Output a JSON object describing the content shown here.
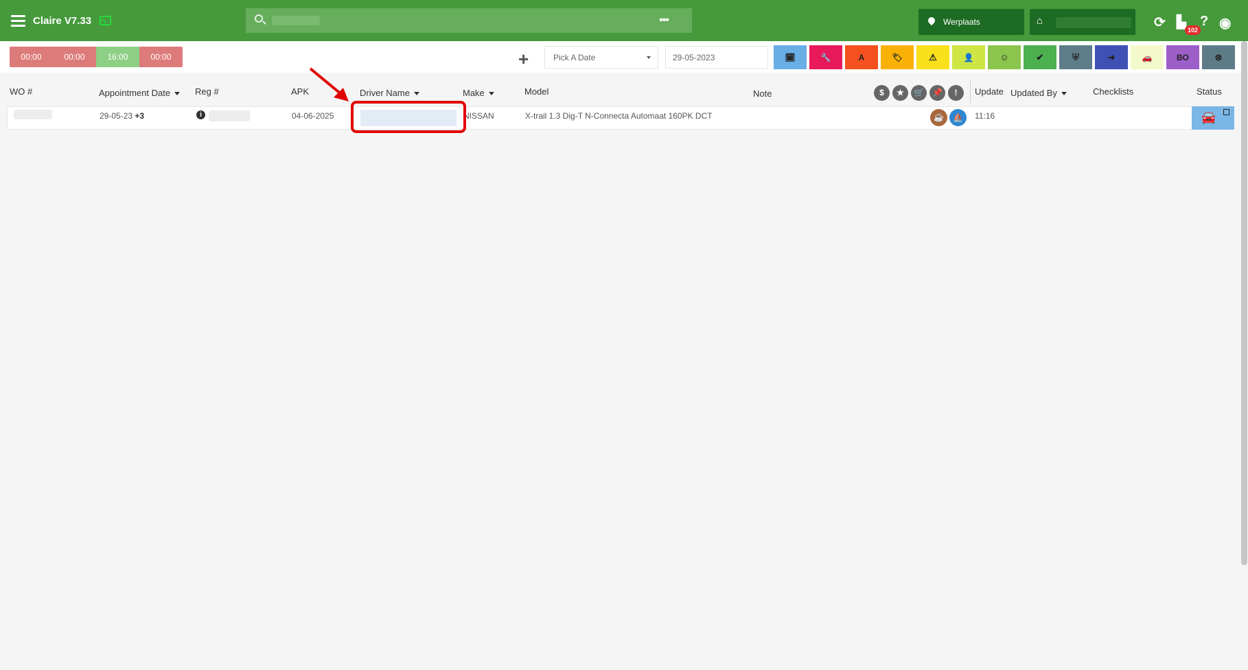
{
  "app": {
    "title": "Claire V7.33"
  },
  "search": {
    "placeholder": "",
    "more_label": "•••"
  },
  "location": {
    "label": "Werplaats"
  },
  "header_icons": {
    "notifications_count": "102",
    "help_label": "?"
  },
  "time_slots": [
    {
      "label": "00:00",
      "color": "#dd7b7b"
    },
    {
      "label": "00:00",
      "color": "#dd7b7b"
    },
    {
      "label": "16:00",
      "color": "#8ccf85"
    },
    {
      "label": "00:00",
      "color": "#dd7b7b"
    }
  ],
  "filters": {
    "add_label": "+",
    "pick_date_label": "Pick A Date",
    "date_value": "29-05-2023",
    "status_buttons": [
      {
        "name": "calendar-filter-button",
        "icon": "calendar-check-icon",
        "glyph": "🗓",
        "color": "#6aaee6"
      },
      {
        "name": "repair-filter-button",
        "icon": "wrench-icon",
        "glyph": "🔧",
        "color": "#e8195b"
      },
      {
        "name": "apk-filter-button",
        "icon": "apk-a-icon",
        "glyph": "A",
        "color": "#f4511e"
      },
      {
        "name": "tag-filter-button",
        "icon": "tag-icon",
        "glyph": "🏷",
        "color": "#f9b107"
      },
      {
        "name": "warning-filter-button",
        "icon": "warning-icon",
        "glyph": "⚠",
        "color": "#f8e11b"
      },
      {
        "name": "user-check-filter-button",
        "icon": "user-check-icon",
        "glyph": "👤",
        "color": "#cde643"
      },
      {
        "name": "smile-filter-button",
        "icon": "smile-icon",
        "glyph": "☺",
        "color": "#8cc54d"
      },
      {
        "name": "double-check-filter-button",
        "icon": "double-check-icon",
        "glyph": "✔",
        "color": "#4cb04f"
      },
      {
        "name": "shield-filter-button",
        "icon": "shield-check-icon",
        "glyph": "⛨",
        "color": "#5f7c89"
      },
      {
        "name": "exit-filter-button",
        "icon": "sign-out-icon",
        "glyph": "➜",
        "color": "#3f51b5"
      },
      {
        "name": "car-filter-button",
        "icon": "car-icon",
        "glyph": "🚗",
        "color": "#f4f9cb"
      },
      {
        "name": "bo-filter-button",
        "icon": "bo-text-icon",
        "glyph": "BO",
        "color": "#9c5fc8"
      },
      {
        "name": "cancel-filter-button",
        "icon": "close-circle-icon",
        "glyph": "⊗",
        "color": "#5e7b88"
      }
    ]
  },
  "table": {
    "headers": {
      "wo": "WO #",
      "appointment_date": "Appointment Date",
      "reg": "Reg #",
      "apk": "APK",
      "driver_name": "Driver Name",
      "make": "Make",
      "model": "Model",
      "note": "Note",
      "update": "Update",
      "updated_by": "Updated By",
      "checklists": "Checklists",
      "status": "Status"
    },
    "header_icons": [
      {
        "icon": "dollar-icon",
        "glyph": "$"
      },
      {
        "icon": "star-icon",
        "glyph": "★"
      },
      {
        "icon": "cart-icon",
        "glyph": "🛒"
      },
      {
        "icon": "pin-icon",
        "glyph": "📌"
      },
      {
        "icon": "warning-icon",
        "glyph": "!"
      }
    ],
    "rows": [
      {
        "wo": "",
        "appointment_date": "29-05-23",
        "appointment_extra": "+3",
        "reg": "",
        "apk": "04-06-2025",
        "driver_name": "",
        "make": "NISSAN",
        "model": "X-trail 1.3 Dig-T N-Connecta Automaat 160PK DCT",
        "note": "",
        "update": "11:16",
        "updated_by": "",
        "checklists": ""
      }
    ]
  }
}
